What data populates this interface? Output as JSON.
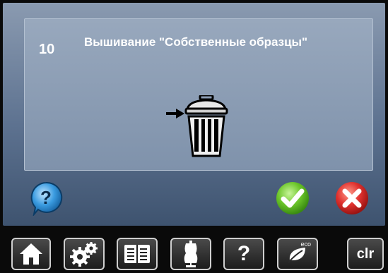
{
  "message": {
    "number": "10",
    "text": "Вышивание \"Собственные образцы\""
  },
  "dialog_buttons": {
    "help": "help-icon",
    "confirm": "checkmark-icon",
    "cancel": "cross-icon"
  },
  "toolbar": {
    "home": "home-icon",
    "setup": "gears-icon",
    "tutorial": "book-icon",
    "consultant": "dress-form-icon",
    "help_label": "?",
    "eco_label": "eco",
    "clr_label": "clr"
  },
  "colors": {
    "confirm": "#6cc62a",
    "cancel": "#e0322f",
    "help": "#2f8fd8"
  }
}
